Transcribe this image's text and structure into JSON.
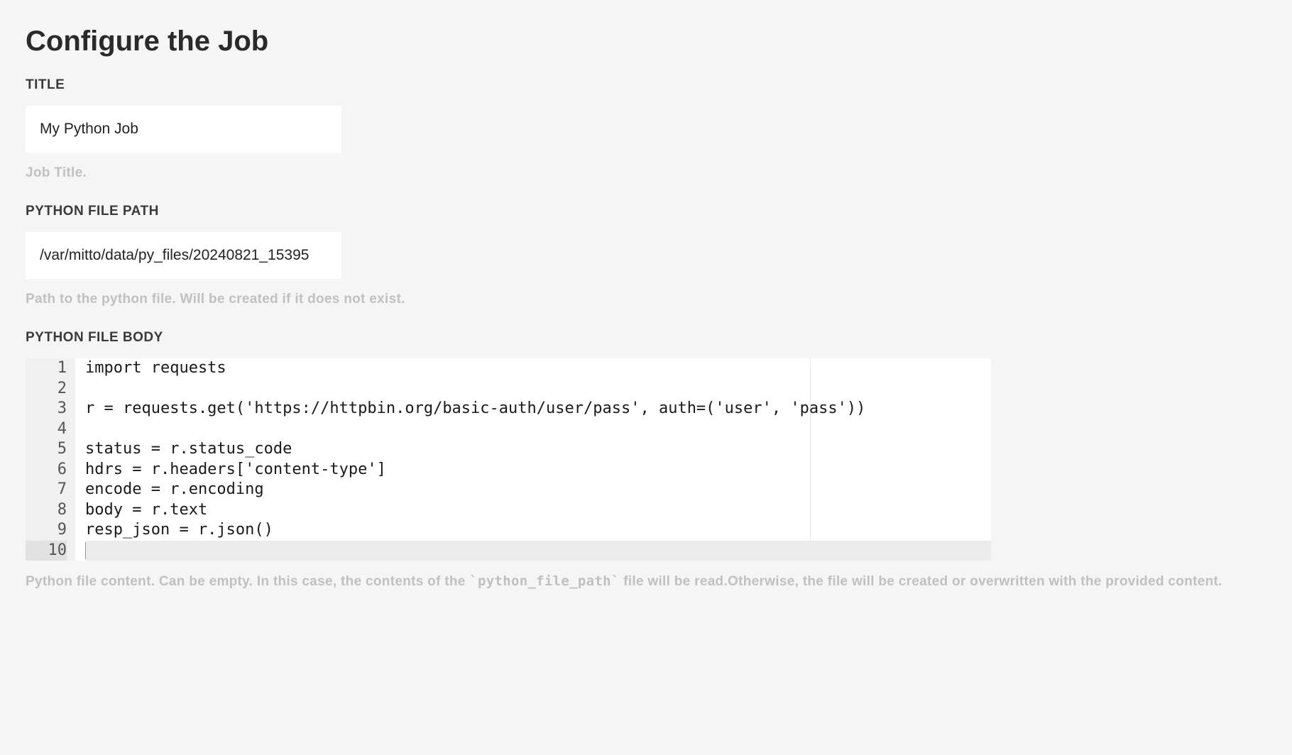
{
  "page": {
    "heading": "Configure the Job"
  },
  "fields": {
    "title": {
      "label": "TITLE",
      "value": "My Python Job",
      "helper": "Job Title."
    },
    "file_path": {
      "label": "PYTHON FILE PATH",
      "value": "/var/mitto/data/py_files/20240821_15395",
      "helper": "Path to the python file. Will be created if it does not exist."
    },
    "file_body": {
      "label": "PYTHON FILE BODY",
      "lines": [
        "import requests",
        "",
        "r = requests.get('https://httpbin.org/basic-auth/user/pass', auth=('user', 'pass'))",
        "",
        "status = r.status_code",
        "hdrs = r.headers['content-type']",
        "encode = r.encoding",
        "body = r.text",
        "resp_json = r.json()",
        ""
      ],
      "active_line_index": 9,
      "helper_pre": "Python file content. Can be empty. In this case, the contents of the ",
      "helper_code": "`python_file_path`",
      "helper_post": " file will be read.Otherwise, the file will be created or overwritten with the provided content."
    }
  }
}
